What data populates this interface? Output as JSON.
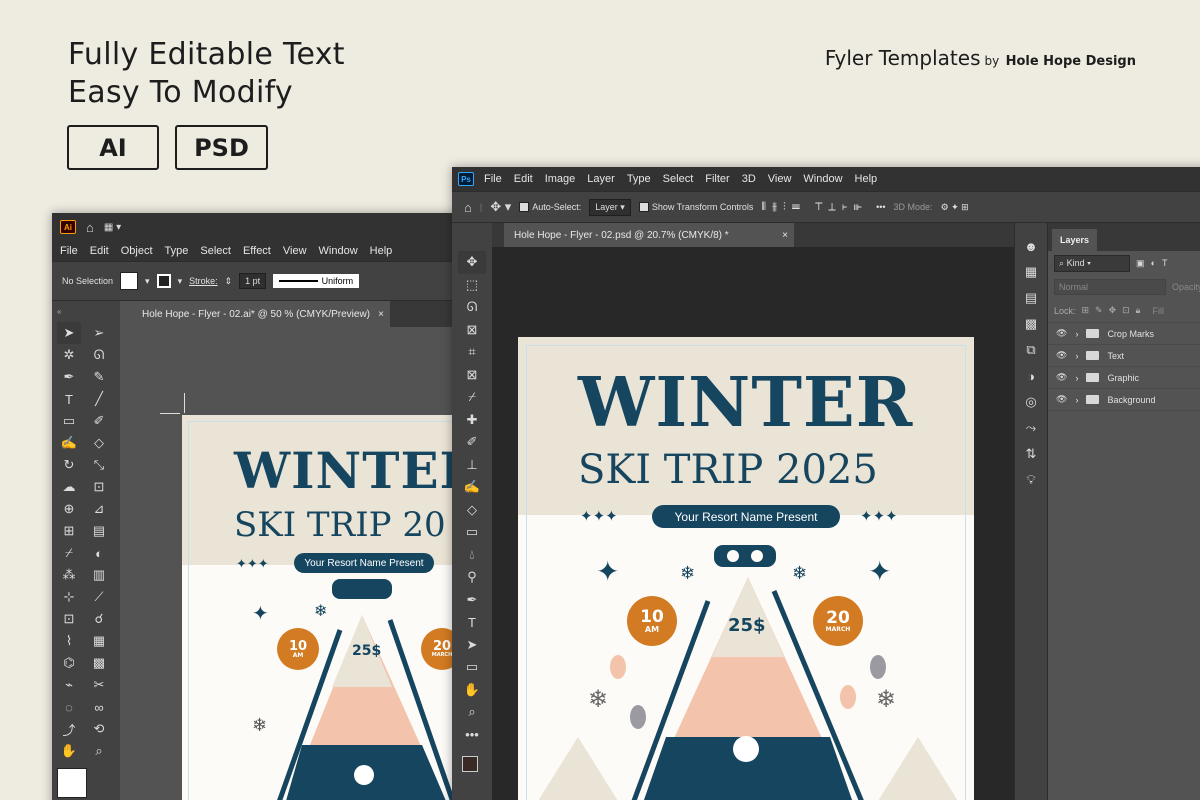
{
  "promo": {
    "headline_1": "Fully Editable Text",
    "headline_2": "Easy To Modify",
    "badge_ai": "AI",
    "badge_psd": "PSD",
    "brand_name": "Fyler Templates",
    "brand_by": "by",
    "brand_author": "Hole Hope Design"
  },
  "illustrator": {
    "logo": "Ai",
    "menu": [
      "File",
      "Edit",
      "Object",
      "Type",
      "Select",
      "Effect",
      "View",
      "Window",
      "Help"
    ],
    "control": {
      "selection": "No Selection",
      "stroke_label": "Stroke:",
      "stroke_value": "1 pt",
      "profile": "Uniform"
    },
    "doc_tab": "Hole Hope - Flyer - 02.ai* @ 50 % (CMYK/Preview)",
    "tab_close": "×"
  },
  "photoshop": {
    "logo": "Ps",
    "menu": [
      "File",
      "Edit",
      "Image",
      "Layer",
      "Type",
      "Select",
      "Filter",
      "3D",
      "View",
      "Window",
      "Help"
    ],
    "options": {
      "auto_select": "Auto-Select:",
      "target": "Layer",
      "show_transform": "Show Transform Controls",
      "mode_3d": "3D Mode:"
    },
    "doc_tab": "Hole Hope - Flyer - 02.psd @ 20.7% (CMYK/8) *",
    "tab_close": "×",
    "layers_panel": {
      "tab": "Layers",
      "filter_kind": "Kind",
      "blend_mode": "Normal",
      "opacity_label": "Opacity",
      "lock_label": "Lock:",
      "fill_label": "Fill",
      "layers": [
        "Crop Marks",
        "Text",
        "Graphic",
        "Background"
      ]
    }
  },
  "flyer": {
    "title": "WINTER",
    "subtitle": "SKI TRIP 2025",
    "subtitle_cropped": "SKI TRIP 20",
    "resort": "Your Resort Name Present",
    "time_num": "10",
    "time_unit": "AM",
    "date_num": "20",
    "date_month": "MARCH",
    "price": "25$"
  },
  "colors": {
    "navy": "#16455f",
    "orange": "#d27b23",
    "peach": "#f3c3ab",
    "cream": "#eae4d6",
    "background": "#eeebe1"
  }
}
